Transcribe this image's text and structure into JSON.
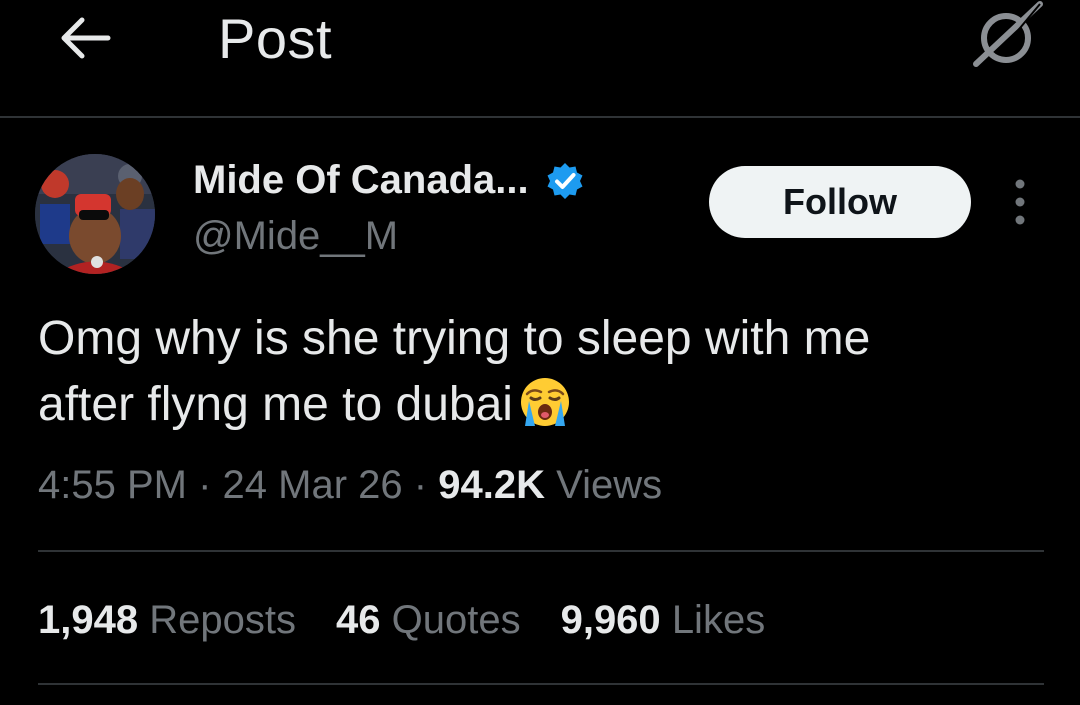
{
  "header": {
    "title": "Post",
    "back_icon": "arrow-left-icon",
    "right_icon": "grok-icon"
  },
  "author": {
    "display_name": "Mide Of Canada...",
    "handle": "@Mide__M",
    "verified": true,
    "verified_color": "#1d9bf0",
    "follow_label": "Follow",
    "more_icon": "more-vertical-icon"
  },
  "post": {
    "text_line1": "Omg why is she trying to sleep with me",
    "text_line2": "after flyng me to dubai",
    "emoji": "loudly-crying-face-emoji"
  },
  "meta": {
    "time": "4:55 PM",
    "separator": "·",
    "date": "24 Mar 26",
    "views_count": "94.2K",
    "views_label": "Views"
  },
  "stats": {
    "reposts_count": "1,948",
    "reposts_label": "Reposts",
    "quotes_count": "46",
    "quotes_label": "Quotes",
    "likes_count": "9,960",
    "likes_label": "Likes"
  },
  "colors": {
    "background": "#000000",
    "primary_text": "#e7e9ea",
    "secondary_text": "#71767b",
    "divider": "#2f3336",
    "follow_bg": "#eff3f4"
  }
}
